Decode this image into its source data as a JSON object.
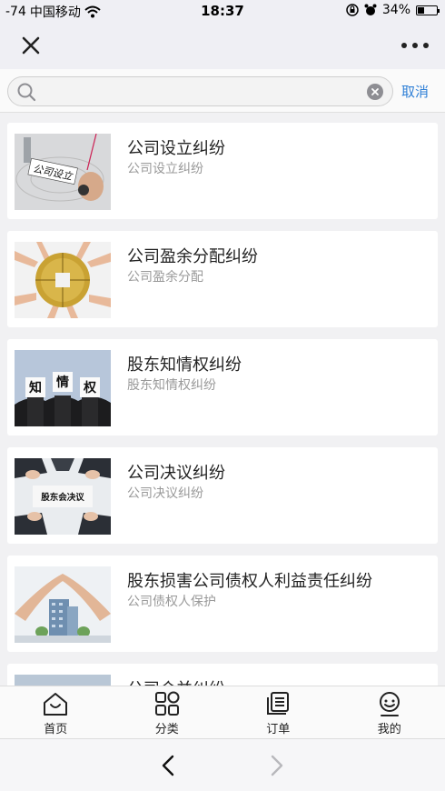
{
  "status_bar": {
    "signal": "-74",
    "carrier": "中国移动",
    "time": "18:37",
    "battery_percent": "34%",
    "battery_level": 0.34
  },
  "search": {
    "value": "",
    "placeholder": "",
    "cancel_label": "取消"
  },
  "items": [
    {
      "title": "公司设立纠纷",
      "subtitle": "公司设立纠纷",
      "image": "company-establishment-photo",
      "image_text": "公司设立"
    },
    {
      "title": "公司盈余分配纠纷",
      "subtitle": "公司盈余分配",
      "image": "coin-hands-photo"
    },
    {
      "title": "股东知情权纠纷",
      "subtitle": "股东知情权纠纷",
      "image": "shareholders-signs-photo",
      "image_signs": [
        "知",
        "情",
        "权"
      ]
    },
    {
      "title": "公司决议纠纷",
      "subtitle": "公司决议纠纷",
      "image": "shareholder-resolution-photo",
      "image_text": "股东会决议"
    },
    {
      "title": "股东损害公司债权人利益责任纠纷",
      "subtitle": "公司债权人保护",
      "image": "hands-protect-building-photo"
    },
    {
      "title": "公司合并纠纷",
      "subtitle": "",
      "image": "partial-photo"
    }
  ],
  "tabs": [
    {
      "label": "首页",
      "icon": "home-icon"
    },
    {
      "label": "分类",
      "icon": "category-icon"
    },
    {
      "label": "订单",
      "icon": "order-icon"
    },
    {
      "label": "我的",
      "icon": "profile-icon"
    }
  ],
  "colors": {
    "accent": "#2e7fd6",
    "background": "#f1f1f3"
  }
}
